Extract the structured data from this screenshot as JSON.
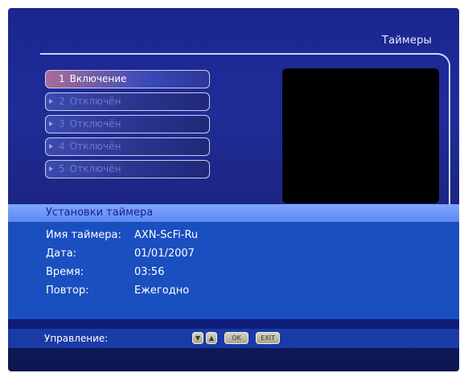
{
  "screen": {
    "title": "Таймеры"
  },
  "timers": [
    {
      "number": "1",
      "status": "Включение",
      "active": true
    },
    {
      "number": "2",
      "status": "Отключён",
      "active": false
    },
    {
      "number": "3",
      "status": "Отключён",
      "active": false
    },
    {
      "number": "4",
      "status": "Отключён",
      "active": false
    },
    {
      "number": "5",
      "status": "Отключён",
      "active": false
    }
  ],
  "settings": {
    "header": "Установки таймера",
    "name_label": "Имя таймера:",
    "name_value": "AXN-ScFi-Ru",
    "date_label": "Дата:",
    "date_value": "01/01/2007",
    "time_label": "Время:",
    "time_value": "03:56",
    "repeat_label": "Повтор:",
    "repeat_value": "Ежегодно"
  },
  "controls": {
    "label": "Управление:",
    "keys": [
      {
        "icon": "arrow-down-icon",
        "glyph": "▼"
      },
      {
        "icon": "arrow-up-icon",
        "glyph": "▲"
      },
      {
        "label": "OK"
      },
      {
        "label": "EXIT"
      }
    ]
  },
  "colors": {
    "background_blue": "#1b2690",
    "settings_blue": "#1a4fc0",
    "header_light_blue": "#7fa6ff",
    "selected_highlight": "#aa6d98"
  }
}
